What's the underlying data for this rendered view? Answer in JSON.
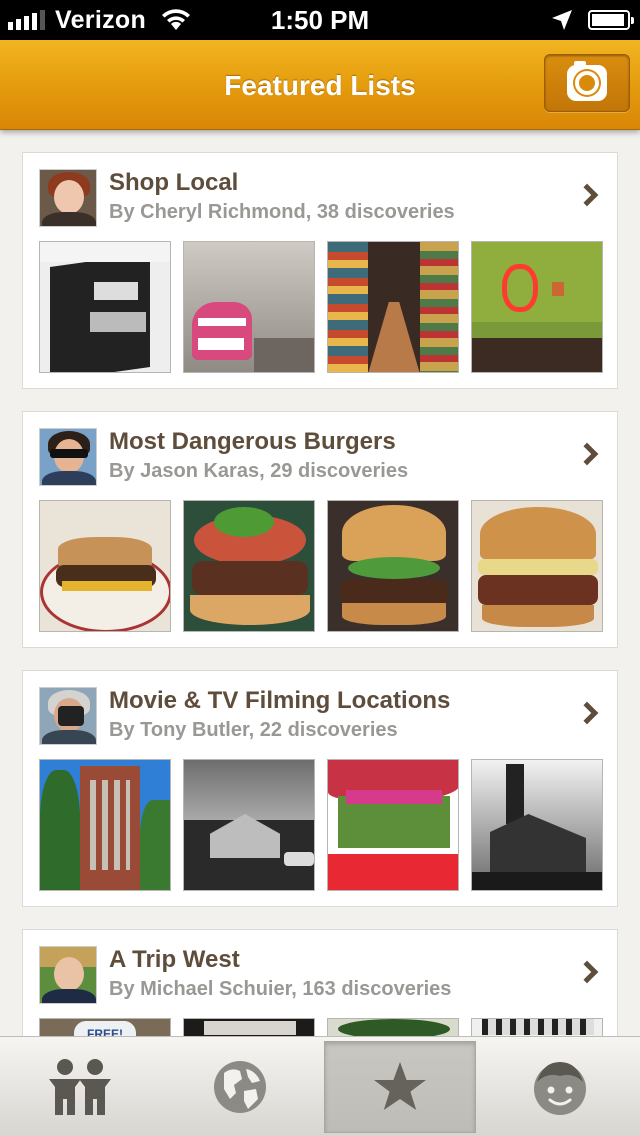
{
  "status_bar": {
    "carrier": "Verizon",
    "time": "1:50 PM",
    "signal_bars": 4,
    "battery_level": 0.95,
    "icons": [
      "signal-icon",
      "wifi-icon",
      "location-arrow-icon",
      "battery-icon"
    ]
  },
  "nav": {
    "title": "Featured Lists",
    "camera_button_icon": "camera-icon"
  },
  "colors": {
    "nav_gradient_top": "#f2b521",
    "nav_gradient_bottom": "#d98706",
    "title_text": "#5e4d3b",
    "subtitle_text": "#9a9894",
    "tab_icon": "#5b5852",
    "background": "#f2f1ee"
  },
  "lists": [
    {
      "title": "Shop Local",
      "subtitle": "By Cheryl Richmond, 38 discoveries",
      "avatar_icon": "user-avatar",
      "thumbnails": [
        "storefront-photo",
        "elephant-car-wash-sign-photo",
        "grocery-aisle-photo",
        "neon-s-sign-photo"
      ]
    },
    {
      "title": "Most Dangerous Burgers",
      "subtitle": "By Jason Karas, 29 discoveries",
      "avatar_icon": "user-avatar",
      "thumbnails": [
        "burger-plate-photo",
        "burger-slaw-photo",
        "burger-lettuce-photo",
        "burger-cheese-photo"
      ]
    },
    {
      "title": "Movie & TV Filming Locations",
      "subtitle": "By Tony Butler, 22 discoveries",
      "avatar_icon": "user-avatar",
      "thumbnails": [
        "brick-tower-building-photo",
        "black-white-house-photo",
        "red-house-photo",
        "ruined-chimney-photo"
      ]
    },
    {
      "title": "A Trip West",
      "subtitle": "By Michael Schuier, 163 discoveries",
      "avatar_icon": "user-avatar",
      "thumbnails": [
        "free-sign-photo",
        "dark-photo",
        "plant-photo",
        "bw-structure-photo"
      ],
      "thumbnail_caption": "FREE!"
    }
  ],
  "tabs": [
    {
      "icon": "people-icon",
      "active": false
    },
    {
      "icon": "globe-icon",
      "active": false
    },
    {
      "icon": "star-icon",
      "active": true
    },
    {
      "icon": "face-icon",
      "active": false
    }
  ]
}
